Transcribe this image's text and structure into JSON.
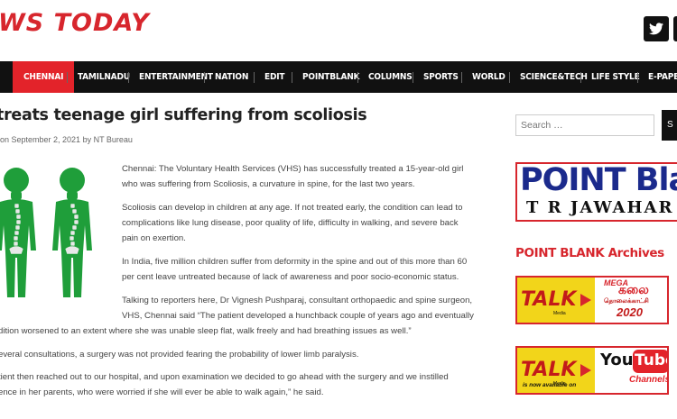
{
  "header": {
    "logo_text": "WS TODAY",
    "social": [
      "twitter-icon",
      "facebook-icon"
    ]
  },
  "nav": {
    "items": [
      "CHENNAI",
      "TAMILNADU",
      "ENTERTAINMENT",
      "NATION",
      "EDIT",
      "POINTBLANK",
      "COLUMNS",
      "SPORTS",
      "WORLD",
      "SCIENCE&TECH",
      "LIFE STYLE",
      "E-PAPER"
    ],
    "active": "CHENNAI"
  },
  "article": {
    "title": "treats teenage girl suffering from scoliosis",
    "meta_prefix": "on September 2, 2021 by ",
    "author": "NT Bureau",
    "paragraphs": [
      [
        "Chennai: The Voluntary Health Services (VHS) has successfully treated a 15-year-old girl",
        "who was suffering from Scoliosis, a curvature in spine, for the last two years."
      ],
      [
        "Scoliosis can develop in children at any age. If not treated early, the condition can lead to",
        "complications like lung disease, poor quality of life, difficulty in walking, and severe back",
        "pain on exertion."
      ],
      [
        "In India, five million children suffer from deformity in the spine and out of this more than 60",
        "per cent leave untreated because of lack of awareness and poor socio-economic status."
      ],
      [
        "Talking to reporters here, Dr Vignesh Pushparaj, consultant orthopaedic and spine surgeon,",
        "VHS, Chennai said “The patient developed a hunchback couple of years ago and eventually",
        "dition worsened to an extent where she was unable sleep flat, walk freely and had breathing issues as well.”"
      ],
      [
        "everal consultations, a surgery was not provided fearing the probability of lower limb paralysis."
      ],
      [
        "tient then reached out to our hospital, and upon examination we decided to go ahead with the surgery and we instilled",
        "ence in her parents, who were worried if she will ever be able to walk again,” he said."
      ]
    ]
  },
  "sidebar": {
    "search_placeholder": "Search …",
    "search_button": "S",
    "ad1": {
      "line1": "POINT Blan",
      "line2": "T R JAWAHAR"
    },
    "archives_heading": "POINT BLANK Archives",
    "ad2": {
      "talk": "TALK",
      "media": "Media",
      "mega": "MEGA",
      "kalai": "கலை",
      "tamil": "தொலைக்காட்சி",
      "year": "2020"
    },
    "ad3": {
      "talk": "TALK",
      "media": "Media",
      "you": "You",
      "tube": "Tube",
      "channels": "Channels",
      "avail": "is now available on"
    }
  },
  "colors": {
    "brand_red": "#d7262d",
    "nav_bg": "#111111",
    "figure_green": "#1f9e3a"
  }
}
